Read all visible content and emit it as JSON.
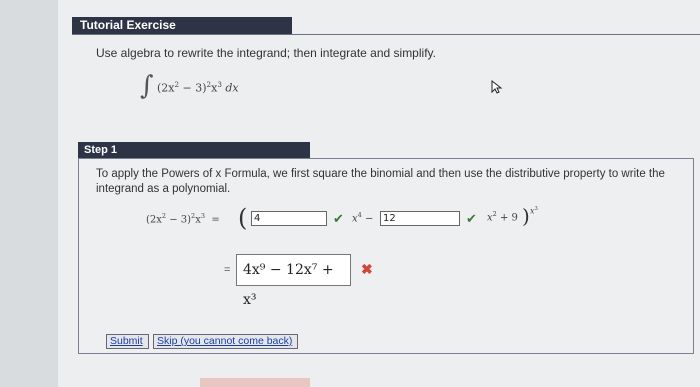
{
  "header": {
    "title": "Tutorial Exercise"
  },
  "problem": {
    "instruction": "Use algebra to rewrite the integrand; then integrate and simplify.",
    "integral_symbol": "∫"
  },
  "step": {
    "title": "Step 1",
    "text": "To apply the Powers of x Formula, we first square the binomial and then use the distributive property to write the integrand as a polynomial.",
    "input1": "4",
    "input2": "12",
    "answer_value": "4x⁹ − 12x⁷ + x³"
  },
  "buttons": {
    "submit": "Submit",
    "skip": "Skip (you cannot come back)"
  },
  "colors": {
    "header_bg": "#2c3446",
    "check_green": "#3a7a3a",
    "error_red": "#d2453c",
    "link_blue": "#1a3ea3"
  },
  "icons": [
    "check-icon",
    "x-mark-icon",
    "pointer-cursor-icon"
  ]
}
